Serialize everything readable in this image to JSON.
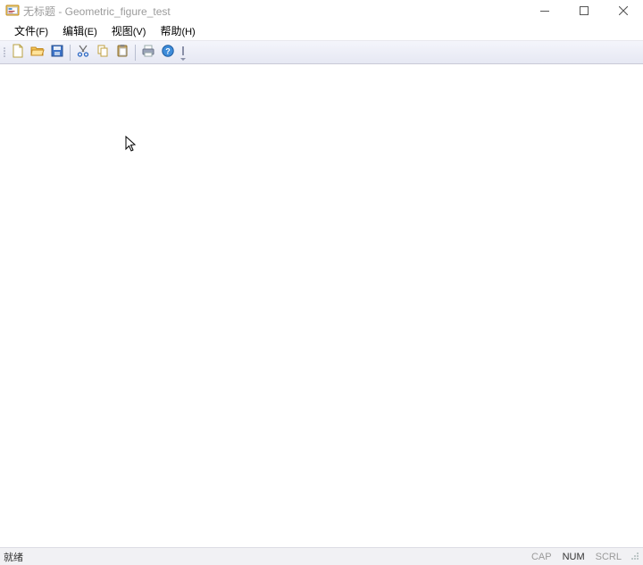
{
  "titlebar": {
    "title": "无标题 - Geometric_figure_test"
  },
  "menu": {
    "file": {
      "label": "文件",
      "accel": "(F)"
    },
    "edit": {
      "label": "编辑",
      "accel": "(E)"
    },
    "view": {
      "label": "视图",
      "accel": "(V)"
    },
    "help": {
      "label": "帮助",
      "accel": "(H)"
    }
  },
  "toolbar": {
    "new": "new-file",
    "open": "open-file",
    "save": "save-file",
    "cut": "cut",
    "copy": "copy",
    "paste": "paste",
    "print": "print",
    "help": "help-about"
  },
  "status": {
    "ready": "就绪",
    "cap": "CAP",
    "num": "NUM",
    "scrl": "SCRL",
    "num_active": true
  }
}
